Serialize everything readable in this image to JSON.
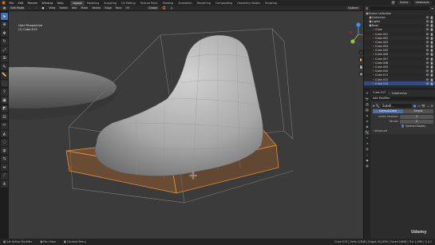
{
  "menu": [
    "File",
    "Edit",
    "Render",
    "Window",
    "Help"
  ],
  "workspaces": [
    "Layout",
    "Modeling",
    "Sculpting",
    "UV Editing",
    "Texture Paint",
    "Shading",
    "Animation",
    "Rendering",
    "Compositing",
    "Geometry Nodes",
    "Scripting"
  ],
  "active_workspace": "Layout",
  "scene": "Scene",
  "view_layer": "ViewLayer",
  "header": {
    "mode": "Edit Mode",
    "menus": [
      "View",
      "Select",
      "Add",
      "Mesh",
      "Vertex",
      "Edge",
      "Face",
      "UV"
    ],
    "orientation": "Global",
    "options": "Options"
  },
  "viewport": {
    "view_name": "User Perspective",
    "object_name": "(1) Cube.013"
  },
  "outliner": {
    "search_placeholder": "",
    "rows": [
      {
        "label": "Scene Collection",
        "icon": "collection-icon",
        "selected": false
      },
      {
        "label": "Collection",
        "icon": "collection-icon",
        "selected": false
      },
      {
        "label": "Lights",
        "icon": "collection-icon",
        "selected": false
      },
      {
        "label": "Base",
        "icon": "collection-icon",
        "selected": false
      },
      {
        "label": "Cube",
        "icon": "mesh-icon",
        "selected": false
      },
      {
        "label": "Cube.001",
        "icon": "mesh-icon",
        "selected": false
      },
      {
        "label": "Cube.002",
        "icon": "mesh-icon",
        "selected": false
      },
      {
        "label": "Cube.003",
        "icon": "mesh-icon",
        "selected": false
      },
      {
        "label": "Cube.004",
        "icon": "mesh-icon",
        "selected": false
      },
      {
        "label": "Cube.005",
        "icon": "mesh-icon",
        "selected": false
      },
      {
        "label": "Cube.006",
        "icon": "mesh-icon",
        "selected": false
      },
      {
        "label": "Cube.007",
        "icon": "mesh-icon",
        "selected": false
      },
      {
        "label": "Cube.008",
        "icon": "mesh-icon",
        "selected": false
      },
      {
        "label": "Cube.009",
        "icon": "mesh-icon",
        "selected": false
      },
      {
        "label": "Cube.010",
        "icon": "mesh-icon",
        "selected": false
      },
      {
        "label": "Cube.011",
        "icon": "mesh-icon",
        "selected": false
      },
      {
        "label": "Cube.012",
        "icon": "mesh-icon",
        "selected": false
      },
      {
        "label": "Cube.013",
        "icon": "mesh-icon",
        "selected": true
      }
    ]
  },
  "properties": {
    "object": "Cube.013",
    "modifier_type": "Subdivision",
    "add_modifier": "Add Modifier",
    "modifier_name": "Subdi...",
    "mode_tabs": [
      "Catmull-Clark",
      "Simple"
    ],
    "active_mode": "Catmull-Clark",
    "fields": [
      {
        "key": "Levels Viewport",
        "value": "1"
      },
      {
        "key": "Render",
        "value": "2"
      }
    ],
    "optimal_display": "Optimal Display",
    "advanced": "Advanced"
  },
  "status": {
    "items": [
      "Set Active Modifier",
      "Pan View",
      "Context Menu"
    ],
    "right": "Cube.013 | Verts 0/848 | Edges 0/1,696 | Faces 0/848 | Tris 1,696 | 3.4.1"
  },
  "brand": "Udemy",
  "colors": {
    "accent": "#4772b3",
    "selection_orange": "#e88f3a",
    "viewport_bg": "#3b3b3b"
  }
}
